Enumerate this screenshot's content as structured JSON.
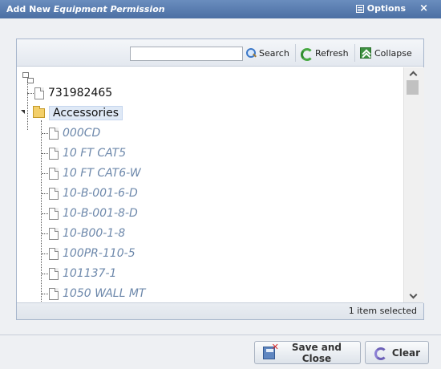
{
  "window": {
    "title_prefix": "Add New ",
    "title_emphasis": "Equipment Permission",
    "options_label": "Options",
    "close_glyph": "×"
  },
  "toolbar": {
    "search_value": "",
    "search_label": "Search",
    "refresh_label": "Refresh",
    "collapse_label": "Collapse"
  },
  "tree": {
    "top_item": "731982465",
    "folder_item": "Accessories",
    "children": [
      "000CD",
      "10 FT CAT5",
      "10 FT CAT6-W",
      "10-B-001-6-D",
      "10-B-001-8-D",
      "10-B00-1-8",
      "100PR-110-5",
      "101137-1",
      "1050 WALL MT"
    ]
  },
  "status": {
    "selected_text": "1 item selected"
  },
  "footer": {
    "save_close_label": "Save and Close",
    "clear_label": "Clear"
  }
}
